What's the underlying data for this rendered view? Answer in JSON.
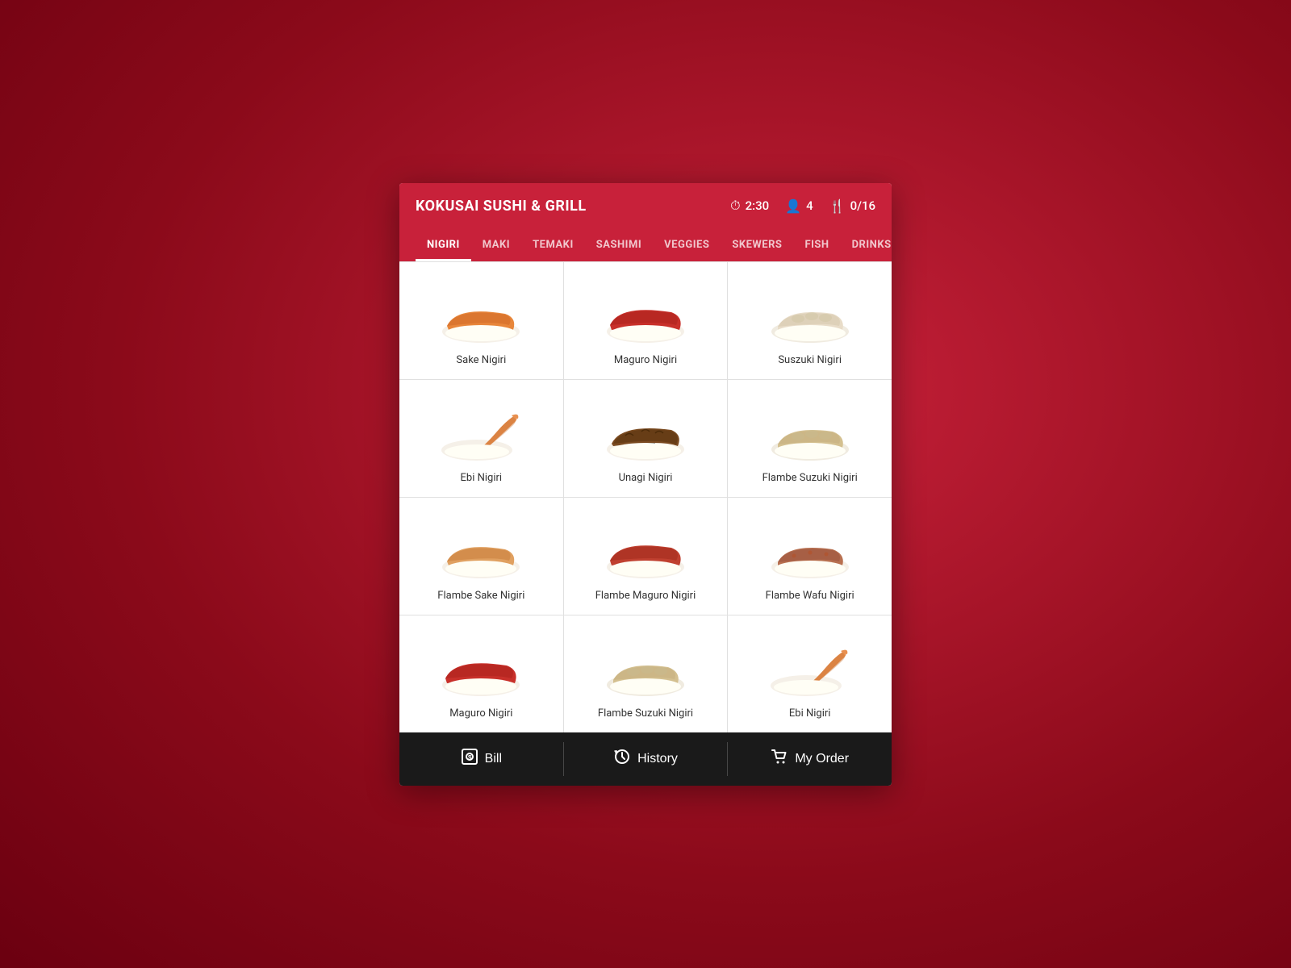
{
  "header": {
    "title": "KOKUSAI SUSHI & GRILL",
    "time": "2:30",
    "guests": "4",
    "order": "0/16"
  },
  "nav": {
    "tabs": [
      {
        "label": "NIGIRI",
        "active": true
      },
      {
        "label": "MAKI",
        "active": false
      },
      {
        "label": "TEMAKI",
        "active": false
      },
      {
        "label": "SASHIMI",
        "active": false
      },
      {
        "label": "VEGGIES",
        "active": false
      },
      {
        "label": "SKEWERS",
        "active": false
      },
      {
        "label": "FISH",
        "active": false
      },
      {
        "label": "DRINKS",
        "active": false
      }
    ]
  },
  "menu": {
    "items": [
      {
        "name": "Sake Nigiri",
        "color1": "#e8863a",
        "color2": "#c96020",
        "type": "salmon"
      },
      {
        "name": "Maguro Nigiri",
        "color1": "#c8302a",
        "color2": "#9b1a14",
        "type": "tuna"
      },
      {
        "name": "Suszuki Nigiri",
        "color1": "#e8dcc8",
        "color2": "#c8b898",
        "type": "white"
      },
      {
        "name": "Ebi Nigiri",
        "color1": "#e89050",
        "color2": "#c87030",
        "type": "shrimp"
      },
      {
        "name": "Unagi Nigiri",
        "color1": "#7a4a20",
        "color2": "#4a2a08",
        "type": "eel"
      },
      {
        "name": "Flambe Suzuki Nigiri",
        "color1": "#d4c090",
        "color2": "#b8a070",
        "type": "white"
      },
      {
        "name": "Flambe Sake Nigiri",
        "color1": "#e0a060",
        "color2": "#c07030",
        "type": "salmon"
      },
      {
        "name": "Flambe Maguro Nigiri",
        "color1": "#c04030",
        "color2": "#902010",
        "type": "tuna"
      },
      {
        "name": "Flambe Wafu Nigiri",
        "color1": "#b87050",
        "color2": "#884030",
        "type": "wafu"
      },
      {
        "name": "Maguro Nigiri",
        "color1": "#c8302a",
        "color2": "#9b1a14",
        "type": "tuna"
      },
      {
        "name": "Flambe Suzuki Nigiri",
        "color1": "#d4c090",
        "color2": "#b8a070",
        "type": "white"
      },
      {
        "name": "Ebi Nigiri",
        "color1": "#e89050",
        "color2": "#c87030",
        "type": "shrimp"
      }
    ]
  },
  "bottomBar": {
    "bill_label": "Bill",
    "history_label": "History",
    "order_label": "My Order"
  }
}
